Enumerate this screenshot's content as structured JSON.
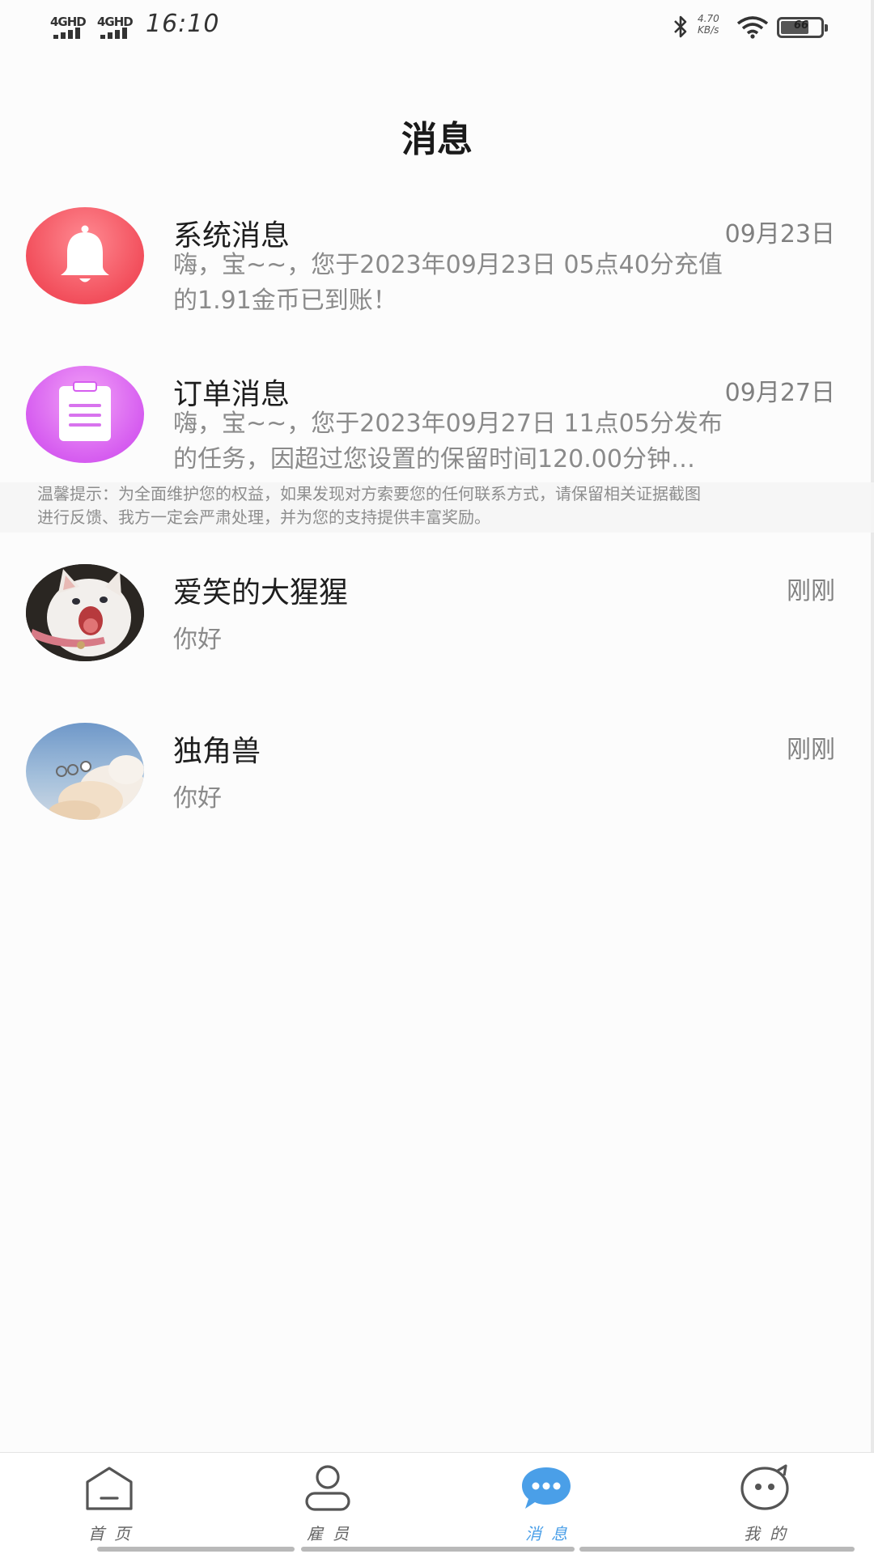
{
  "status_bar": {
    "net1": "4GHD",
    "net2": "4GHD",
    "time": "16:10",
    "speed_value": "4.70",
    "speed_unit": "KB/s",
    "battery_level": "66"
  },
  "header": {
    "title": "消息"
  },
  "conversations": [
    {
      "name": "系统消息",
      "time": "09月23日",
      "preview_line1": "嗨，宝~~，您于2023年09月23日 05点40分充值",
      "preview_line2": "的1.91金币已到账！",
      "avatar_icon": "bell-icon",
      "avatar_color": "#f2555f"
    },
    {
      "name": "订单消息",
      "time": "09月27日",
      "preview_line1": "嗨，宝~~，您于2023年09月27日 11点05分发布",
      "preview_line2": "的任务，因超过您设置的保留时间120.00分钟…",
      "avatar_icon": "clipboard-icon",
      "avatar_color": "#cf58e8"
    },
    {
      "name": "爱笑的大猩猩",
      "time": "刚刚",
      "preview_line1": "你好",
      "avatar_icon": "cat-photo-avatar"
    },
    {
      "name": "独角兽",
      "time": "刚刚",
      "preview_line1": "你好",
      "avatar_icon": "sky-cloud-photo-avatar"
    }
  ],
  "tip": {
    "line1": "温馨提示：为全面维护您的权益，如果发现对方索要您的任何联系方式，请保留相关证据截图",
    "line2": "进行反馈、我方一定会严肃处理，并为您的支持提供丰富奖励。"
  },
  "bottom_nav": [
    {
      "label": "首页",
      "icon": "home-icon",
      "active": false
    },
    {
      "label": "雇员",
      "icon": "person-icon",
      "active": false
    },
    {
      "label": "消息",
      "icon": "chat-bubble-icon",
      "active": true
    },
    {
      "label": "我的",
      "icon": "smiley-bubble-icon",
      "active": false
    }
  ],
  "colors": {
    "accent": "#4a9fe8"
  }
}
